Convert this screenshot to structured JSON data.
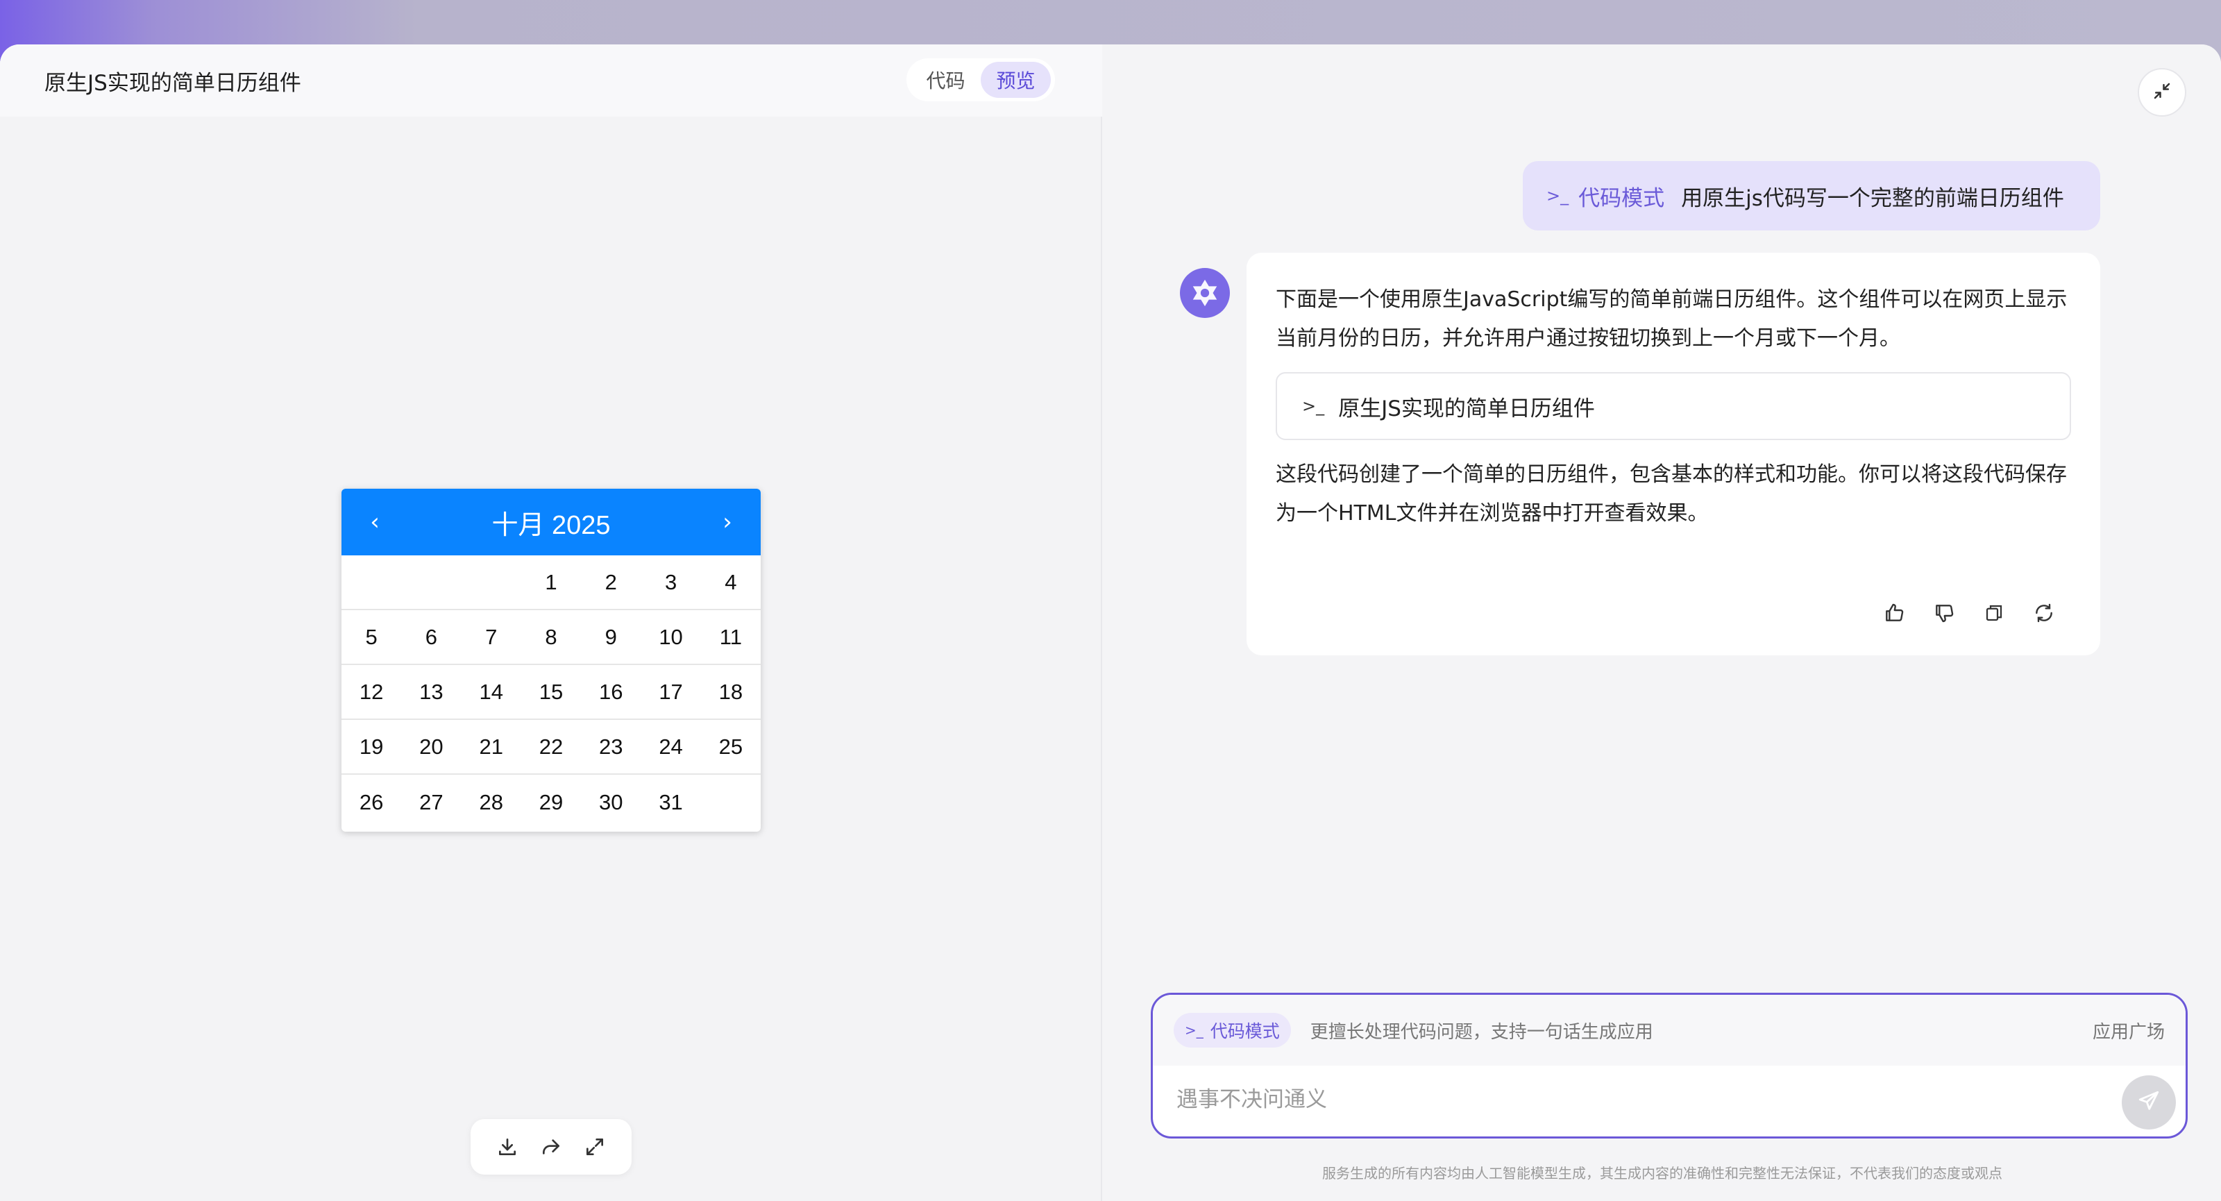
{
  "left": {
    "title": "原生JS实现的简单日历组件",
    "tabs": [
      {
        "label": "代码",
        "active": false
      },
      {
        "label": "预览",
        "active": true
      }
    ],
    "calendar": {
      "prev": "‹",
      "next": "›",
      "month_title": "十月 2025",
      "rows": [
        [
          "",
          "",
          "",
          "1",
          "2",
          "3",
          "4"
        ],
        [
          "5",
          "6",
          "7",
          "8",
          "9",
          "10",
          "11"
        ],
        [
          "12",
          "13",
          "14",
          "15",
          "16",
          "17",
          "18"
        ],
        [
          "19",
          "20",
          "21",
          "22",
          "23",
          "24",
          "25"
        ],
        [
          "26",
          "27",
          "28",
          "29",
          "30",
          "31",
          ""
        ]
      ],
      "header_color": "#0a84ff"
    },
    "toolbar_icons": [
      "download-icon",
      "share-icon",
      "fullscreen-icon"
    ]
  },
  "right": {
    "user_message": {
      "mode_label": "代码模式",
      "text": "用原生js代码写一个完整的前端日历组件"
    },
    "bot_message": {
      "para1": "下面是一个使用原生JavaScript编写的简单前端日历组件。这个组件可以在网页上显示当前月份的日历，并允许用户通过按钮切换到上一个月或下一个月。",
      "code_card_title": "原生JS实现的简单日历组件",
      "para2": "这段代码创建了一个简单的日历组件，包含基本的样式和功能。你可以将这段代码保存为一个HTML文件并在浏览器中打开查看效果。",
      "actions": [
        "thumbs-up-icon",
        "thumbs-down-icon",
        "copy-icon",
        "regenerate-icon"
      ]
    },
    "composer": {
      "mode_chip": "代码模式",
      "hint": "更擅长处理代码问题，支持一句话生成应用",
      "apps_link": "应用广场",
      "placeholder": "遇事不决问通义"
    },
    "disclaimer": "服务生成的所有内容均由人工智能模型生成，其生成内容的准确性和完整性无法保证，不代表我们的态度或观点"
  },
  "colors": {
    "accent": "#6b58d8",
    "calendar_header": "#0a84ff",
    "user_bubble": "#e5e1fb"
  }
}
